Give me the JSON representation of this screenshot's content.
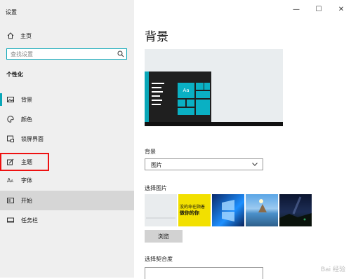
{
  "app": {
    "title": "设置"
  },
  "nav": {
    "home_label": "主页",
    "search_placeholder": "查找设置",
    "section_title": "个性化",
    "items": [
      {
        "label": "背景",
        "icon": "picture-icon"
      },
      {
        "label": "颜色",
        "icon": "palette-icon"
      },
      {
        "label": "锁屏界面",
        "icon": "lock-screen-icon"
      },
      {
        "label": "主题",
        "icon": "theme-icon",
        "highlighted": true
      },
      {
        "label": "字体",
        "icon": "font-icon"
      },
      {
        "label": "开始",
        "icon": "start-icon",
        "selected": true
      },
      {
        "label": "任务栏",
        "icon": "taskbar-icon"
      }
    ]
  },
  "window_controls": {
    "minimize": "—",
    "maximize": "☐",
    "close": "✕"
  },
  "main": {
    "heading": "背景",
    "preview_tile_text": "Aa",
    "background_label": "背景",
    "background_value": "图片",
    "choose_picture_label": "选择图片",
    "browse_label": "浏览",
    "fit_label": "选择契合度"
  },
  "thumbnail_text": {
    "line1": "没的命在顾着",
    "line2": "做你的你"
  },
  "colors": {
    "accent": "#0aa7b8",
    "sidebar_bg": "#efefef",
    "highlight_border": "#e11111"
  },
  "watermark": "Bai 经验"
}
